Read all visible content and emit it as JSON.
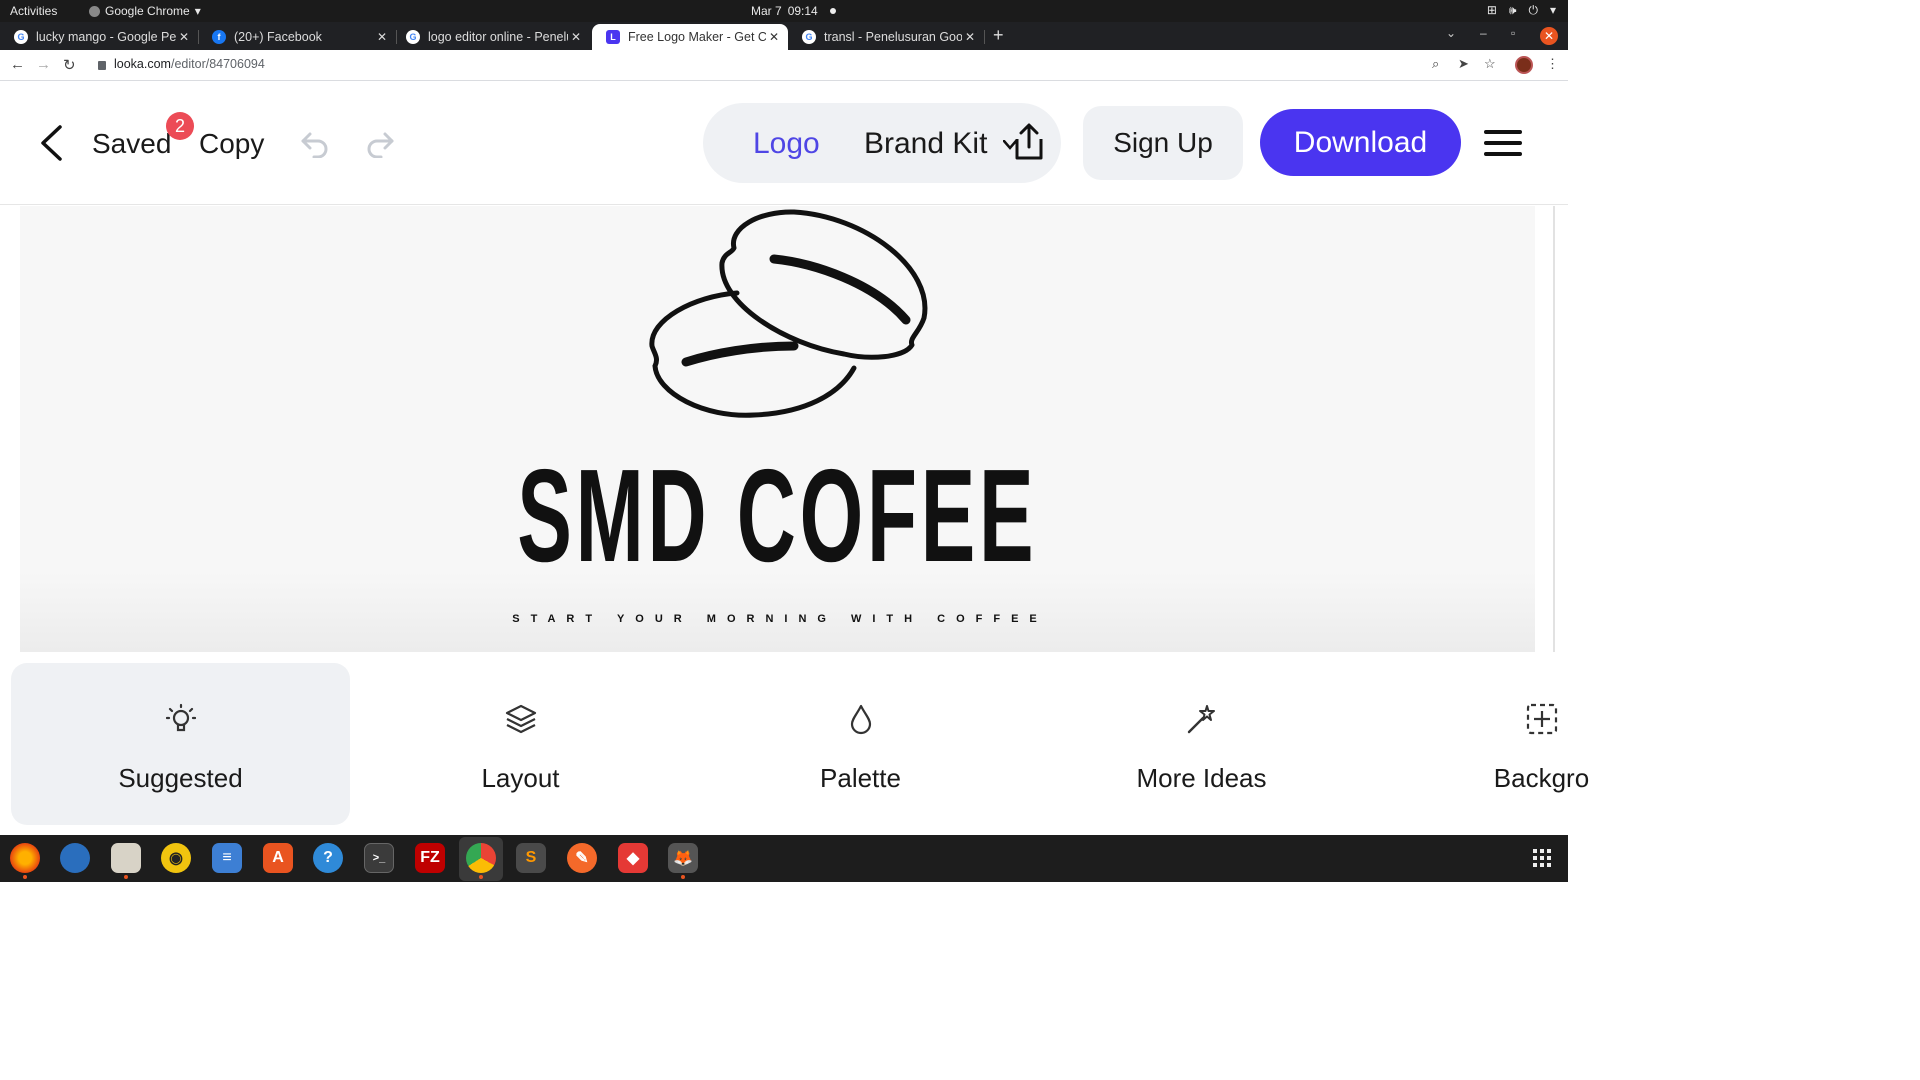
{
  "system": {
    "activities": "Activities",
    "app_name": "Google Chrome",
    "date": "Mar 7",
    "time": "09:14"
  },
  "browser": {
    "tabs": [
      {
        "title": "lucky mango - Google Pen",
        "favicon": "google-icon"
      },
      {
        "title": "(20+) Facebook",
        "favicon": "facebook-icon"
      },
      {
        "title": "logo editor online - Penelu",
        "favicon": "google-icon"
      },
      {
        "title": "Free Logo Maker - Get Cus",
        "favicon": "looka-icon",
        "active": true
      },
      {
        "title": "transl - Penelusuran Goog",
        "favicon": "google-icon"
      }
    ],
    "url_host": "looka.com",
    "url_path": "/editor/84706094"
  },
  "header": {
    "saved_label": "Saved",
    "notification_count": "2",
    "copy_label": "Copy",
    "logo_tab": "Logo",
    "brand_kit_tab": "Brand Kit",
    "signup_label": "Sign Up",
    "download_label": "Download"
  },
  "canvas": {
    "brand_name": "SMD COFEE",
    "tagline": "START YOUR MORNING WITH COFFEE"
  },
  "tools": [
    {
      "label": "Suggested",
      "icon": "lightbulb-icon",
      "active": true
    },
    {
      "label": "Layout",
      "icon": "layers-icon"
    },
    {
      "label": "Palette",
      "icon": "droplet-icon"
    },
    {
      "label": "More Ideas",
      "icon": "magic-wand-icon"
    },
    {
      "label": "Backgro",
      "icon": "background-grid-icon"
    }
  ],
  "colors": {
    "accent": "#4a35f0",
    "logo_tab_text": "#4f46e5",
    "badge": "#ec4b56",
    "ubuntu_orange": "#e95420"
  }
}
